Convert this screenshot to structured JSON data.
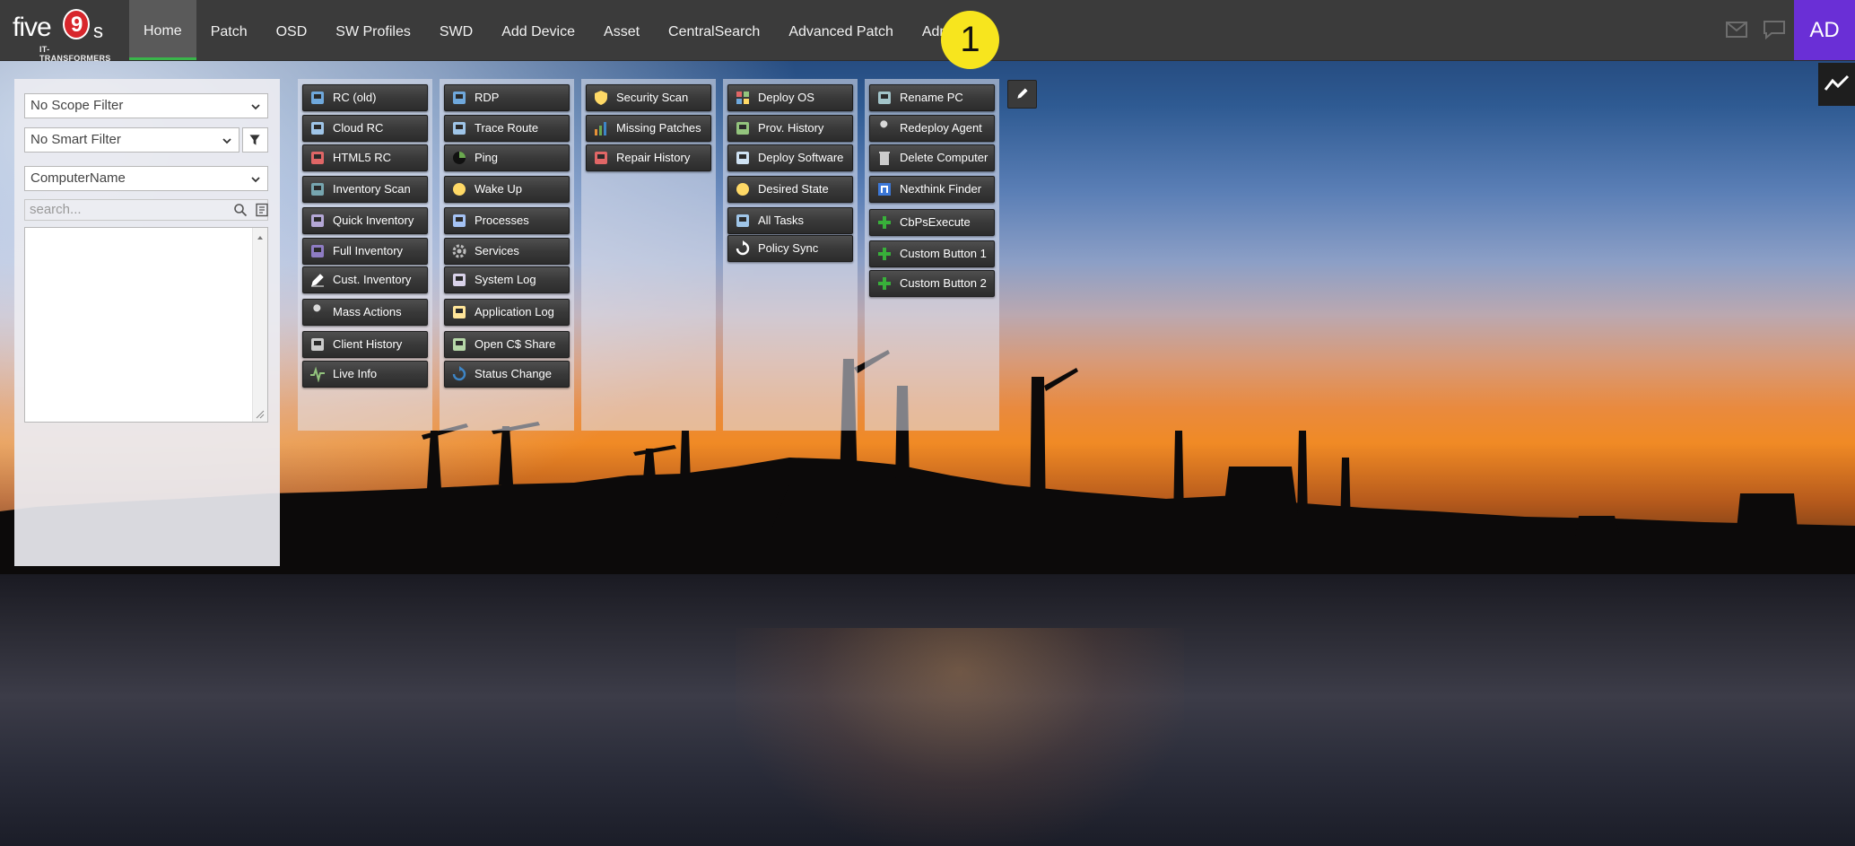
{
  "logo": {
    "brand_left": "five",
    "brand_nine": "9",
    "brand_right": "s",
    "tagline": "IT-TRANSFORMERS"
  },
  "nav": {
    "items": [
      {
        "label": "Home",
        "active": true
      },
      {
        "label": "Patch"
      },
      {
        "label": "OSD"
      },
      {
        "label": "SW Profiles"
      },
      {
        "label": "SWD"
      },
      {
        "label": "Add Device"
      },
      {
        "label": "Asset"
      },
      {
        "label": "CentralSearch"
      },
      {
        "label": "Advanced Patch"
      },
      {
        "label": "Admin"
      }
    ],
    "callout": "1",
    "user_initials": "AD"
  },
  "filters": {
    "scope": "No Scope Filter",
    "smart": "No Smart Filter",
    "field": "ComputerName",
    "search_placeholder": "search..."
  },
  "columns": [
    [
      {
        "label": "RC (old)",
        "icon": "remote-control-icon"
      },
      {
        "label": "Cloud RC",
        "icon": "cloud-rc-icon"
      },
      {
        "label": "HTML5 RC",
        "icon": "html5-icon"
      },
      {
        "label": "Inventory Scan",
        "icon": "inventory-scan-icon"
      },
      {
        "label": "Quick Inventory",
        "icon": "quick-inventory-icon"
      },
      {
        "label": "Full Inventory",
        "icon": "full-inventory-icon"
      },
      {
        "label": "Cust. Inventory",
        "icon": "pencil-icon"
      },
      {
        "label": "Mass Actions",
        "icon": "wrench-icon"
      },
      {
        "label": "Client History",
        "icon": "history-icon"
      },
      {
        "label": "Live Info",
        "icon": "pulse-icon"
      }
    ],
    [
      {
        "label": "RDP",
        "icon": "rdp-icon"
      },
      {
        "label": "Trace Route",
        "icon": "globe-icon"
      },
      {
        "label": "Ping",
        "icon": "ping-icon"
      },
      {
        "label": "Wake Up",
        "icon": "smiley-icon"
      },
      {
        "label": "Processes",
        "icon": "processes-icon"
      },
      {
        "label": "Services",
        "icon": "gear-icon"
      },
      {
        "label": "System Log",
        "icon": "system-log-icon"
      },
      {
        "label": "Application Log",
        "icon": "application-log-icon"
      },
      {
        "label": "Open C$ Share",
        "icon": "share-icon"
      },
      {
        "label": "Status Change",
        "icon": "refresh-icon"
      }
    ],
    [
      {
        "label": "Security Scan",
        "icon": "shield-icon"
      },
      {
        "label": "Missing Patches",
        "icon": "bar-chart-icon"
      },
      {
        "label": "Repair History",
        "icon": "repair-icon"
      }
    ],
    [
      {
        "label": "Deploy OS",
        "icon": "windows-icon"
      },
      {
        "label": "Prov. History",
        "icon": "provisioning-icon"
      },
      {
        "label": "Deploy Software",
        "icon": "software-icon"
      },
      {
        "label": "Desired State",
        "icon": "desired-state-icon"
      },
      {
        "label": "All Tasks",
        "icon": "tasks-icon"
      },
      {
        "label": "Policy Sync",
        "icon": "sync-icon"
      }
    ],
    [
      {
        "label": "Rename PC",
        "icon": "rename-icon"
      },
      {
        "label": "Redeploy Agent",
        "icon": "tools-icon"
      },
      {
        "label": "Delete Computer",
        "icon": "trash-icon"
      },
      {
        "label": "Nexthink Finder",
        "icon": "nexthink-icon"
      },
      {
        "label": "CbPsExecute",
        "icon": "plus-icon"
      },
      {
        "label": "Custom Button 1",
        "icon": "plus-icon"
      },
      {
        "label": "Custom Button 2",
        "icon": "plus-icon"
      }
    ]
  ]
}
